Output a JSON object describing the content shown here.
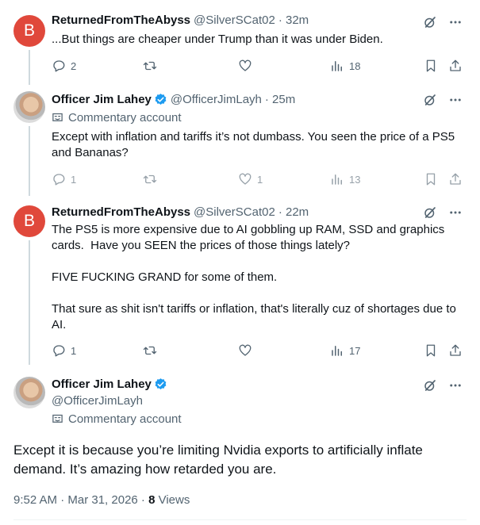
{
  "replies": [
    {
      "avatar_letter": "B",
      "name": "ReturnedFromTheAbyss",
      "handle": "@SilverSCat02",
      "time": "· 32m",
      "text": "...But things are cheaper under Trump than it was under Biden.",
      "replies_count": "2",
      "likes_count": "",
      "views_count": "18"
    },
    {
      "name": "Officer Jim Lahey",
      "handle": "@OfficerJimLayh",
      "time": "· 25m",
      "commentary": "Commentary account",
      "text": "Except with inflation and tariffs it’s not dumbass. You seen the price of a PS5 and Bananas?",
      "replies_count": "1",
      "likes_count": "1",
      "views_count": "13"
    },
    {
      "avatar_letter": "B",
      "name": "ReturnedFromTheAbyss",
      "handle": "@SilverSCat02",
      "time": "· 22m",
      "text": "The PS5 is more expensive due to AI gobbling up RAM, SSD and graphics cards.  Have you SEEN the prices of those things lately?\n\nFIVE FUCKING GRAND for some of them.\n\nThat sure as shit isn't tariffs or inflation, that's literally cuz of shortages due to AI.",
      "replies_count": "1",
      "likes_count": "",
      "views_count": "17"
    }
  ],
  "main": {
    "name": "Officer Jim Lahey",
    "handle": "@OfficerJimLayh",
    "commentary": "Commentary account",
    "text": "Except it is because you’re limiting Nvidia exports to artificially inflate demand. It’s amazing how retarded you are.",
    "time": "9:52 AM · Mar 31, 2026 · ",
    "views_number": "8",
    "views_label": " Views"
  },
  "icons": {
    "grok": "grok-icon",
    "more": "more-icon",
    "reply": "reply-icon",
    "retweet": "retweet-icon",
    "like": "like-icon",
    "views": "views-icon",
    "bookmark": "bookmark-icon",
    "share": "share-icon",
    "verified": "verified-icon",
    "commentary": "commentary-icon"
  },
  "colors": {
    "verified": "#1d9bf0",
    "avatar_b": "#e0483b",
    "muted": "#536471"
  }
}
